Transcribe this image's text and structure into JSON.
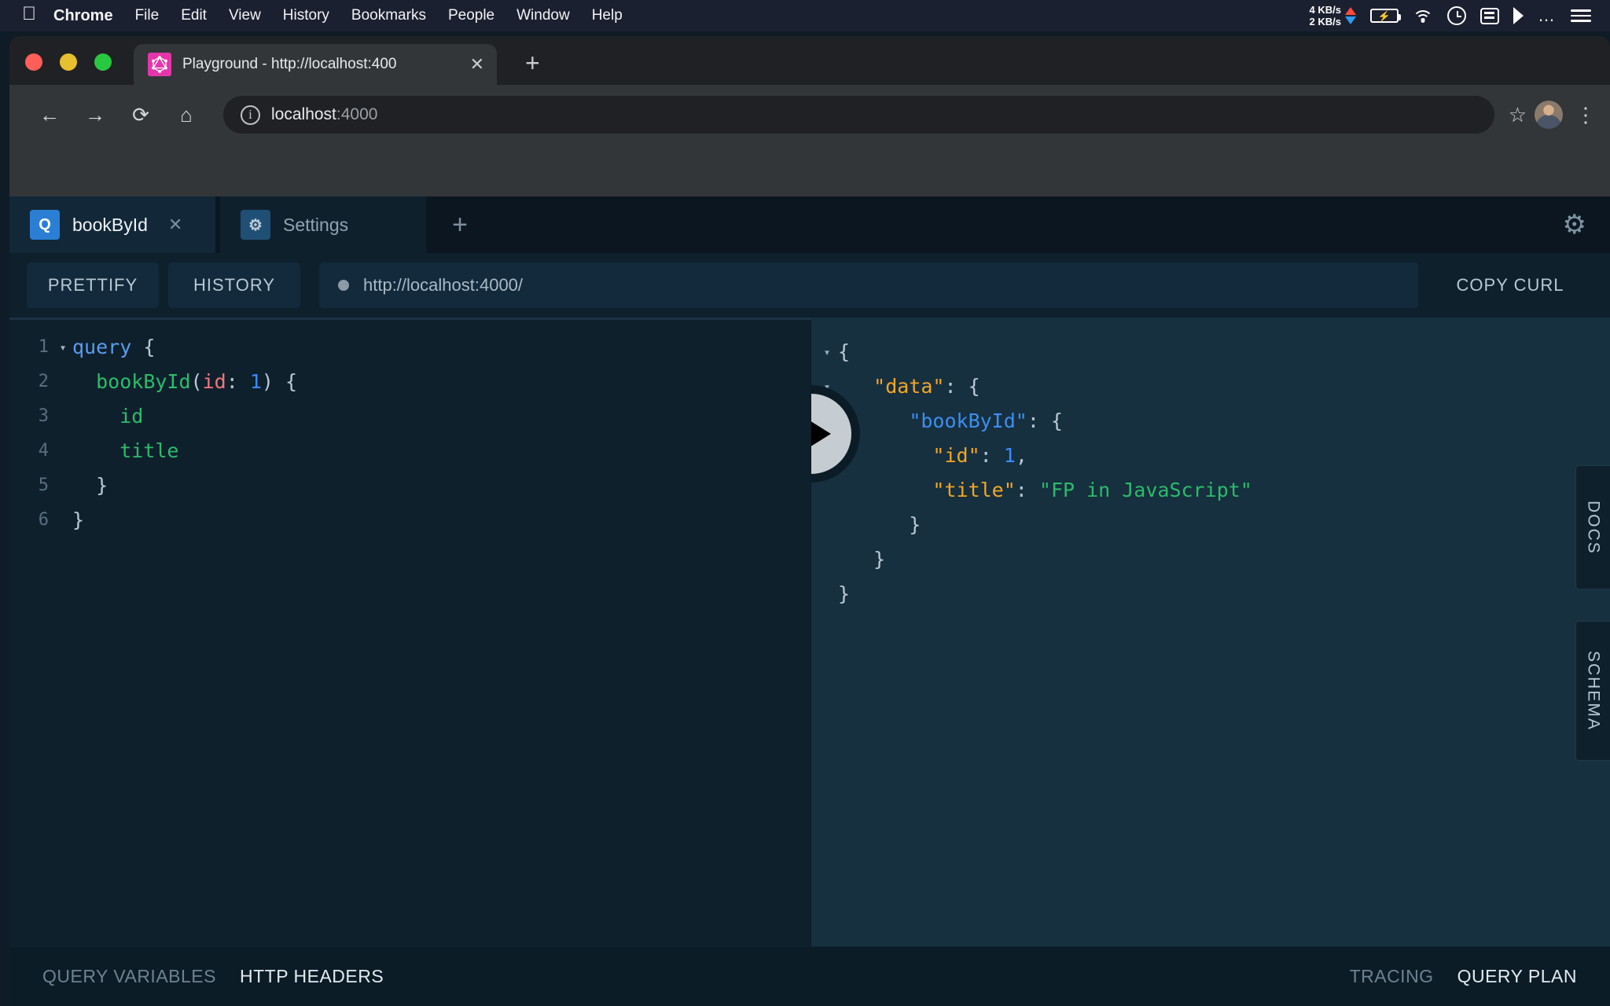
{
  "menubar": {
    "apple_icon": "apple-logo",
    "items": [
      {
        "label": "Chrome",
        "bold": true
      },
      {
        "label": "File",
        "bold": false
      },
      {
        "label": "Edit",
        "bold": false
      },
      {
        "label": "View",
        "bold": false
      },
      {
        "label": "History",
        "bold": false
      },
      {
        "label": "Bookmarks",
        "bold": false
      },
      {
        "label": "People",
        "bold": false
      },
      {
        "label": "Window",
        "bold": false
      },
      {
        "label": "Help",
        "bold": false
      }
    ],
    "network": {
      "up": "4 KB/s",
      "down": "2 KB/s",
      "up_color": "#ff4a3d",
      "down_color": "#2f9bf5"
    },
    "battery_icon": "battery-charging-icon",
    "wifi_icon": "wifi-icon",
    "clock_icon": "clock-icon",
    "list_icon": "list-icon",
    "flag_icon": "flag-icon",
    "more_icon": "ellipsis-icon",
    "menu_icon": "hamburger-icon"
  },
  "browser": {
    "traffic_lights": {
      "close": "#ff5f57",
      "minimize": "#e6c02e",
      "maximize": "#28c840"
    },
    "tab": {
      "favicon": "graphql-logo-icon",
      "title": "Playground - http://localhost:400",
      "close_label": "✕"
    },
    "new_tab_label": "+",
    "nav": {
      "back": "←",
      "forward": "→",
      "reload": "⟳",
      "home": "⌂",
      "bookmark": "☆",
      "menu": "⋮"
    },
    "omnibox": {
      "url_main": "localhost",
      "url_port": ":4000",
      "info_icon": "info-icon"
    }
  },
  "playground": {
    "tabs": [
      {
        "label": "bookById",
        "badge": "Q",
        "badge_type": "q",
        "active": true,
        "close": "✕"
      },
      {
        "label": "Settings",
        "badge": "⚙",
        "badge_type": "s",
        "active": false,
        "close": ""
      }
    ],
    "new_tab_label": "+",
    "settings_gear_icon": "gear-icon",
    "toolbar": {
      "prettify_label": "PRETTIFY",
      "history_label": "HISTORY",
      "endpoint_url": "http://localhost:4000/",
      "copy_curl_label": "COPY CURL",
      "status_dot_color": "#8b9aa6"
    },
    "editor": {
      "lines": [
        {
          "num": "1",
          "fold": "▾",
          "tokens": [
            {
              "t": "query",
              "c": "k-query"
            },
            {
              "t": " {",
              "c": "k-punc"
            }
          ]
        },
        {
          "num": "2",
          "fold": "",
          "tokens": [
            {
              "t": "  ",
              "c": "k-punc"
            },
            {
              "t": "bookById",
              "c": "k-field"
            },
            {
              "t": "(",
              "c": "k-punc"
            },
            {
              "t": "id",
              "c": "k-arg"
            },
            {
              "t": ": ",
              "c": "k-punc"
            },
            {
              "t": "1",
              "c": "k-num"
            },
            {
              "t": ") {",
              "c": "k-punc"
            }
          ]
        },
        {
          "num": "3",
          "fold": "",
          "tokens": [
            {
              "t": "    ",
              "c": "k-punc"
            },
            {
              "t": "id",
              "c": "k-field"
            }
          ]
        },
        {
          "num": "4",
          "fold": "",
          "tokens": [
            {
              "t": "    ",
              "c": "k-punc"
            },
            {
              "t": "title",
              "c": "k-field"
            }
          ]
        },
        {
          "num": "5",
          "fold": "",
          "tokens": [
            {
              "t": "  }",
              "c": "k-punc"
            }
          ]
        },
        {
          "num": "6",
          "fold": "",
          "tokens": [
            {
              "t": "}",
              "c": "k-punc"
            }
          ]
        }
      ]
    },
    "response": {
      "lines": [
        {
          "fold": "▾",
          "tokens": [
            {
              "t": "{",
              "c": "j-punc"
            }
          ]
        },
        {
          "fold": "▾",
          "tokens": [
            {
              "t": "   ",
              "c": "j-punc"
            },
            {
              "t": "\"data\"",
              "c": "j-key"
            },
            {
              "t": ": {",
              "c": "j-punc"
            }
          ]
        },
        {
          "fold": "",
          "tokens": [
            {
              "t": "      ",
              "c": "j-punc"
            },
            {
              "t": "\"bookById\"",
              "c": "j-key2"
            },
            {
              "t": ": {",
              "c": "j-punc"
            }
          ]
        },
        {
          "fold": "",
          "tokens": [
            {
              "t": "        ",
              "c": "j-punc"
            },
            {
              "t": "\"id\"",
              "c": "j-key"
            },
            {
              "t": ": ",
              "c": "j-punc"
            },
            {
              "t": "1",
              "c": "j-num"
            },
            {
              "t": ",",
              "c": "j-punc"
            }
          ]
        },
        {
          "fold": "",
          "tokens": [
            {
              "t": "        ",
              "c": "j-punc"
            },
            {
              "t": "\"title\"",
              "c": "j-key"
            },
            {
              "t": ": ",
              "c": "j-punc"
            },
            {
              "t": "\"FP in JavaScript\"",
              "c": "j-str"
            }
          ]
        },
        {
          "fold": "",
          "tokens": [
            {
              "t": "      }",
              "c": "j-punc"
            }
          ]
        },
        {
          "fold": "",
          "tokens": [
            {
              "t": "   }",
              "c": "j-punc"
            }
          ]
        },
        {
          "fold": "",
          "tokens": [
            {
              "t": "}",
              "c": "j-punc"
            }
          ]
        }
      ]
    },
    "play_button_label": "execute-query",
    "side_tabs": [
      {
        "label": "DOCS",
        "key": "docs"
      },
      {
        "label": "SCHEMA",
        "key": "schema"
      }
    ],
    "footer": {
      "left": [
        {
          "label": "QUERY VARIABLES",
          "active": false
        },
        {
          "label": "HTTP HEADERS",
          "active": true
        }
      ],
      "right": [
        {
          "label": "TRACING",
          "active": false
        },
        {
          "label": "QUERY PLAN",
          "active": true
        }
      ]
    }
  }
}
